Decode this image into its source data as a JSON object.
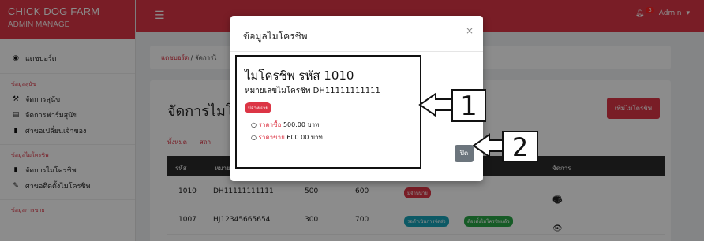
{
  "sidebar": {
    "brand_line1": "CHICK DOG FARM",
    "brand_line2": "ADMIN MANAGE",
    "dashboard": "แดชบอร์ด",
    "sections": [
      {
        "header": "ข้อมูลสุนัข",
        "items": [
          "จัดการสุนัข",
          "จัดการฟาร์มสุนัข",
          "ศาขอเปลี่ยนเจ้าของ"
        ]
      },
      {
        "header": "ข้อมูลไมโครชิพ",
        "items": [
          "จัดการไมโครชิพ",
          "ศาขอติดตั้งไมโครชิพ"
        ]
      },
      {
        "header": "ข้อมูลการขาย",
        "items": []
      }
    ]
  },
  "navbar": {
    "badge_count": "3",
    "user_label": "Admin"
  },
  "breadcrumb": {
    "home": "แดชบอร์ด",
    "current": "จัดการไ"
  },
  "page": {
    "title": "จัดการไมโ",
    "add_button": "เพิ่มไมโครชิพ",
    "filters": [
      "ทั้งหมด",
      "สถา"
    ]
  },
  "table": {
    "headers": [
      "รหัส",
      "หมาย",
      "",
      "",
      "",
      "จัดการ"
    ],
    "rows": [
      {
        "code": "1010",
        "micro_no": "DH11111111111",
        "buy": "500",
        "sell": "600",
        "badges": [
          "มีจำหน่าย"
        ]
      },
      {
        "code": "1007",
        "micro_no": "HJ12345665654",
        "buy": "300",
        "sell": "700",
        "badges": [
          "รอดำเนินการจัดส่ง",
          "ต้องตั้งไมโครชิพแล้ว"
        ]
      }
    ]
  },
  "modal": {
    "title": "ข้อมูลไมโครชิพ",
    "close_symbol": "×",
    "code_title": "ไมโครชิพ รหัส 1010",
    "micro_no_line": "หมายเลขไมโครชิพ DH11111111111",
    "status_badge": "มีจำหน่าย",
    "buy_label": "ราคาซื้อ",
    "buy_value": "500.00 บาท",
    "sell_label": "ราคาขาย",
    "sell_value": "600.00 บาท",
    "close_button": "ปิด"
  },
  "callouts": {
    "one": "1",
    "two": "2"
  },
  "colors": {
    "accent": "#dc3545",
    "dark_header": "#2b2b2b",
    "close_button": "#6c757d",
    "success": "#28a745",
    "info": "#17a2b8"
  }
}
